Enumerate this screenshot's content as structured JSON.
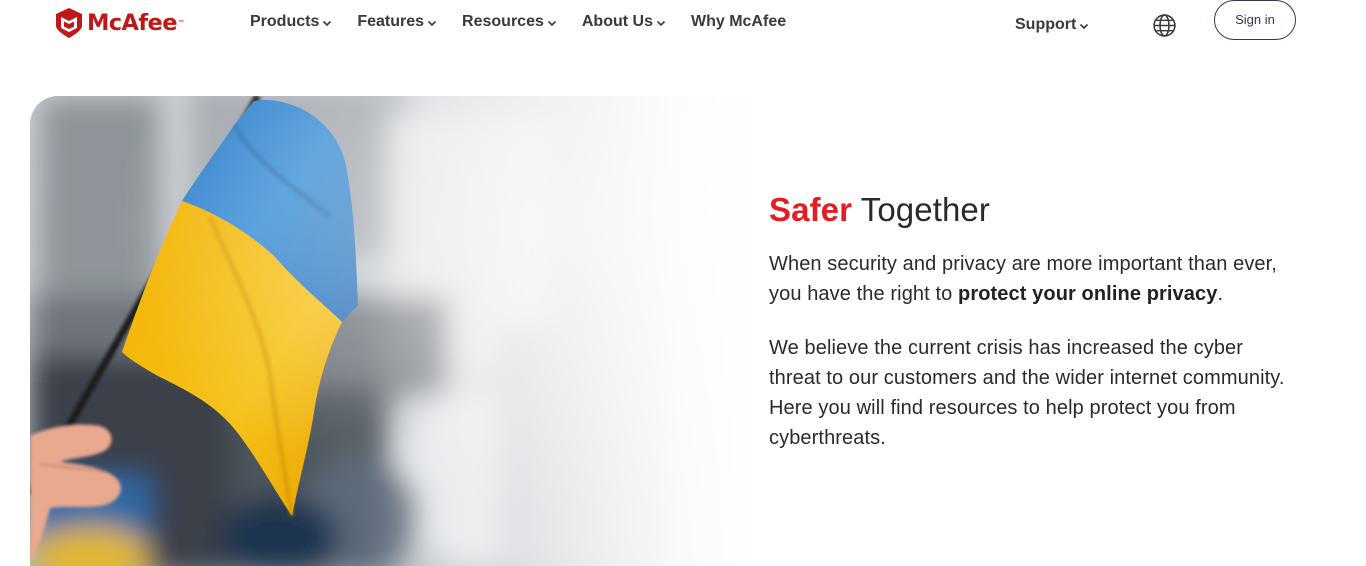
{
  "brand": {
    "name": "McAfee",
    "trademark": "™",
    "color": "#c01818"
  },
  "nav": {
    "items": [
      {
        "label": "Products",
        "has_dropdown": true
      },
      {
        "label": "Features",
        "has_dropdown": true
      },
      {
        "label": "Resources",
        "has_dropdown": true
      },
      {
        "label": "About Us",
        "has_dropdown": true
      },
      {
        "label": "Why McAfee",
        "has_dropdown": false
      }
    ],
    "support_label": "Support",
    "globe_icon": "globe-icon",
    "signin_label": "Sign in"
  },
  "hero": {
    "image_icon": "ukraine-flag-photo",
    "title_accent": "Safer",
    "title_rest": "Together",
    "accent_color": "#e51c23",
    "p1_start": "When security and privacy are more important than ever, you have the right to",
    "p1_bold": "protect your online privacy",
    "p1_end": ".",
    "p2": "We believe the current crisis has increased the cyber threat to our customers and the wider internet community. Here you will find resources to help protect you from cyberthreats."
  }
}
